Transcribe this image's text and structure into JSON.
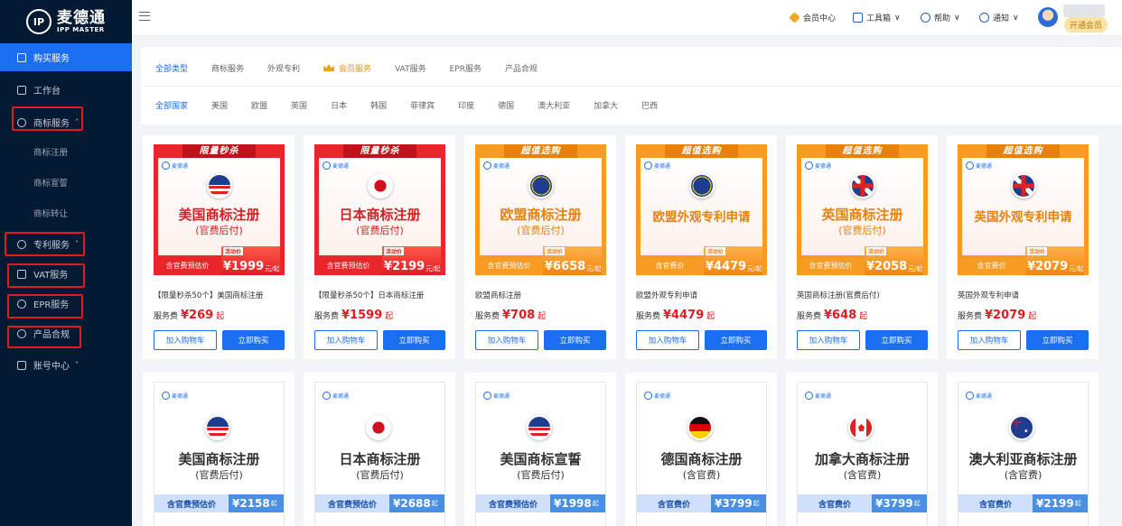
{
  "app": {
    "logo_cn": "麦德通",
    "logo_en": "IPP MASTER"
  },
  "sidebar": {
    "items": [
      {
        "label": "购买服务",
        "active": true
      },
      {
        "label": "工作台"
      },
      {
        "label": "商标服务",
        "chevron": "˄"
      },
      {
        "label": "商标注册",
        "sub": true
      },
      {
        "label": "商标宣誓",
        "sub": true
      },
      {
        "label": "商标转让",
        "sub": true
      },
      {
        "label": "专利服务",
        "chevron": "˅"
      },
      {
        "label": "VAT服务"
      },
      {
        "label": "EPR服务"
      },
      {
        "label": "产品合规"
      },
      {
        "label": "账号中心",
        "chevron": "˅"
      }
    ]
  },
  "topbar": {
    "member_center": "会员中心",
    "toolbox": "工具箱",
    "help": "帮助",
    "notice": "通知",
    "vip_badge": "开通会员",
    "chevron": "∨"
  },
  "filters": {
    "types": [
      "全部类型",
      "商标服务",
      "外观专利",
      "会员服务",
      "VAT服务",
      "EPR服务",
      "产品合规"
    ],
    "countries": [
      "全部国家",
      "美国",
      "欧盟",
      "英国",
      "日本",
      "韩国",
      "菲律宾",
      "印度",
      "德国",
      "澳大利亚",
      "加拿大",
      "巴西"
    ]
  },
  "row1": [
    {
      "banner": "限量秒杀",
      "title": "美国商标注册",
      "sub": "(官费后付)",
      "bar_label": "含官费预估价",
      "bar_tag": "活动价",
      "bar_price": "¥1999",
      "bar_unit": "元/起",
      "name": "【限量秒杀50个】美国商标注册",
      "fee_label": "服务费",
      "price": "¥269",
      "price_unit": "起",
      "cart": "加入购物车",
      "buy": "立即购买",
      "theme": "red",
      "flag": "us"
    },
    {
      "banner": "限量秒杀",
      "title": "日本商标注册",
      "sub": "(官费后付)",
      "bar_label": "含官费预估价",
      "bar_tag": "活动价",
      "bar_price": "¥2199",
      "bar_unit": "元/起",
      "name": "【限量秒杀50个】日本商标注册",
      "fee_label": "服务费",
      "price": "¥1599",
      "price_unit": "起",
      "cart": "加入购物车",
      "buy": "立即购买",
      "theme": "red",
      "flag": "jp"
    },
    {
      "banner": "超值选购",
      "title": "欧盟商标注册",
      "sub": "(官费后付)",
      "bar_label": "含官费预估价",
      "bar_tag": "活动价",
      "bar_price": "¥6658",
      "bar_unit": "元/起",
      "name": "欧盟商标注册",
      "fee_label": "服务费",
      "price": "¥708",
      "price_unit": "起",
      "cart": "加入购物车",
      "buy": "立即购买",
      "theme": "org",
      "flag": "eu"
    },
    {
      "banner": "超值选购",
      "title": "欧盟外观专利申请",
      "sub": "",
      "bar_label": "含官费价",
      "bar_tag": "活动价",
      "bar_price": "¥4479",
      "bar_unit": "元/起",
      "name": "欧盟外观专利申请",
      "fee_label": "服务费",
      "price": "¥4479",
      "price_unit": "起",
      "cart": "加入购物车",
      "buy": "立即购买",
      "theme": "org",
      "flag": "eu",
      "small": true
    },
    {
      "banner": "超值选购",
      "title": "英国商标注册",
      "sub": "(官费后付)",
      "bar_label": "含官费预估价",
      "bar_tag": "活动价",
      "bar_price": "¥2058",
      "bar_unit": "元/起",
      "name": "英国商标注册(官费后付)",
      "fee_label": "服务费",
      "price": "¥648",
      "price_unit": "起",
      "cart": "加入购物车",
      "buy": "立即购买",
      "theme": "org",
      "flag": "uk"
    },
    {
      "banner": "超值选购",
      "title": "英国外观专利申请",
      "sub": "",
      "bar_label": "含官费价",
      "bar_tag": "活动价",
      "bar_price": "¥2079",
      "bar_unit": "元/起",
      "name": "英国外观专利申请",
      "fee_label": "服务费",
      "price": "¥2079",
      "price_unit": "起",
      "cart": "加入购物车",
      "buy": "立即购买",
      "theme": "org",
      "flag": "uk",
      "small": true
    }
  ],
  "row2": [
    {
      "title": "美国商标注册",
      "sub": "(官费后付)",
      "bar_label": "含官费预估价",
      "bar_price": "¥2158",
      "bar_unit": "起",
      "flag": "us"
    },
    {
      "title": "日本商标注册",
      "sub": "(官费后付)",
      "bar_label": "含官费预估价",
      "bar_price": "¥2688",
      "bar_unit": "起",
      "flag": "jp"
    },
    {
      "title": "美国商标宣誓",
      "sub": "(官费后付)",
      "bar_label": "含官费预估价",
      "bar_price": "¥1998",
      "bar_unit": "起",
      "flag": "us"
    },
    {
      "title": "德国商标注册",
      "sub": "(含官费)",
      "bar_label": "含官费价",
      "bar_price": "¥3799",
      "bar_unit": "起",
      "flag": "de"
    },
    {
      "title": "加拿大商标注册",
      "sub": "(含官费)",
      "bar_label": "含官费价",
      "bar_price": "¥3799",
      "bar_unit": "起",
      "flag": "ca"
    },
    {
      "title": "澳大利亚商标注册",
      "sub": "(含官费)",
      "bar_label": "含官费价",
      "bar_price": "¥2199",
      "bar_unit": "起",
      "flag": "au"
    }
  ],
  "minilogo": {
    "cn": "麦德通",
    "en": "IPP MASTER"
  },
  "colors": {
    "primary": "#1a6ef0",
    "sidebar": "#041a33",
    "promo_red": "#e9262a",
    "promo_orange": "#f79b23",
    "highlight_box": "#e01b1b"
  }
}
